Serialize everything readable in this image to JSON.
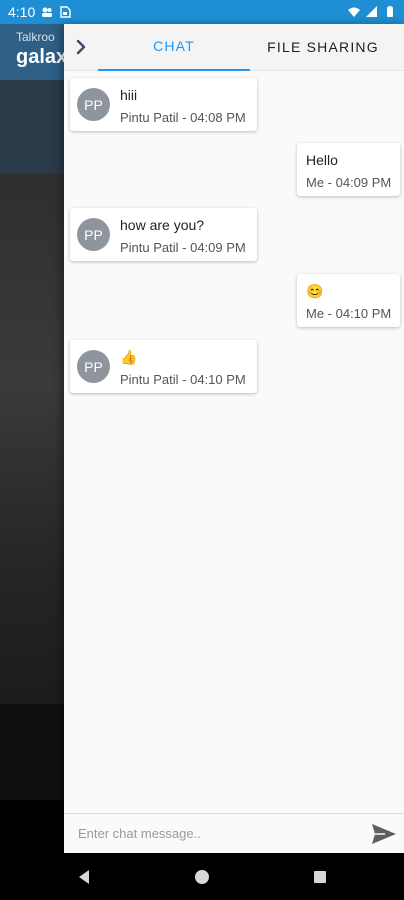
{
  "status_bar": {
    "time": "4:10",
    "icons_left": [
      "notification-icon",
      "sim-icon"
    ],
    "icons_right": [
      "wifi-icon",
      "signal-icon",
      "battery-icon"
    ]
  },
  "background": {
    "subtitle": "Talkroo",
    "title": "galax"
  },
  "tabs": {
    "chat_label": "CHAT",
    "files_label": "FILE SHARING",
    "active": "chat"
  },
  "messages": [
    {
      "direction": "in",
      "initials": "PP",
      "text": "hiii",
      "meta": "Pintu Patil - 04:08 PM"
    },
    {
      "direction": "out",
      "text": "Hello",
      "meta": "Me - 04:09 PM"
    },
    {
      "direction": "in",
      "initials": "PP",
      "text": "how are you?",
      "meta": "Pintu Patil - 04:09 PM"
    },
    {
      "direction": "out",
      "text": "😊",
      "meta": "Me - 04:10 PM"
    },
    {
      "direction": "in",
      "initials": "PP",
      "text": "👍",
      "meta": "Pintu Patil - 04:10 PM"
    }
  ],
  "input": {
    "placeholder": "Enter chat message..",
    "value": ""
  },
  "colors": {
    "status_bar": "#1e8fd5",
    "accent": "#2196f3",
    "avatar": "#8e959d"
  }
}
